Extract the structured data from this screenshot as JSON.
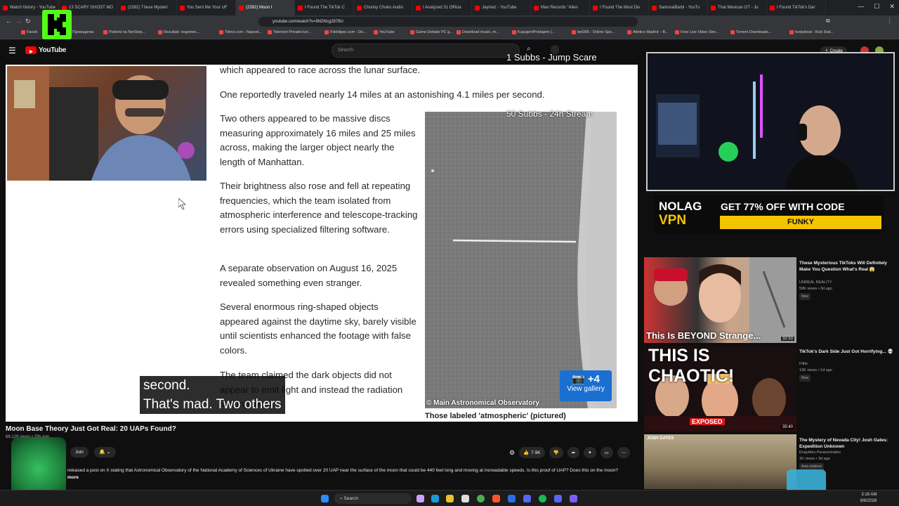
{
  "browser": {
    "tabs": [
      {
        "label": "Watch history - YouTube",
        "active": false
      },
      {
        "label": "13 SCARY GHOST MO",
        "active": false
      },
      {
        "label": "(2392) These Mysteri",
        "active": false
      },
      {
        "label": "You Sent Me Your UF",
        "active": false
      },
      {
        "label": "(2392) Moon I",
        "active": true
      },
      {
        "label": "I Found The TikTok C",
        "active": false
      },
      {
        "label": "Chunky Choko Audio",
        "active": false
      },
      {
        "label": "I Analyzed 31 Officia",
        "active": false
      },
      {
        "label": "Jaymez - YouTube",
        "active": false
      },
      {
        "label": "Man Records \"Alien",
        "active": false
      },
      {
        "label": "I Found The Most Dis",
        "active": false
      },
      {
        "label": "SamuraiBarbi - YouTu",
        "active": false
      },
      {
        "label": "That Mexican OT - Jo",
        "active": false
      },
      {
        "label": "I Found TikTok's Dar",
        "active": false
      }
    ],
    "url": "youtube.com/watch?v=9hDNcg2878U",
    "bookmarks": [
      "Faceb",
      "Преводачка",
      "Pokloni na NorStop...",
      "Rezultati: nogomet,...",
      "Titlovi.com - Najved...",
      "Telemori Privatni kor...",
      "FileHippo.com - Do...",
      "YouTube",
      "Game-Debate PC g...",
      "Download music, m...",
      "KupujemProdajem |...",
      "bet365 - Online Spo...",
      "Atletico Madrid – B...",
      "Free Live Video Stre...",
      "Torrent Downloads...",
      "funkybeat - Kick Stat..."
    ]
  },
  "youtube": {
    "logo": "YouTube",
    "search_placeholder": "Search",
    "create_label": "Create"
  },
  "overlay": {
    "subs_line1": "1 Subbs - Jump Scare",
    "subs_line2": "50 Subbs - 24h Stream"
  },
  "article": {
    "paragraphs": [
      "which appeared to race across the lunar surface.",
      "One reportedly traveled nearly 14 miles at an astonishing 4.1 miles per second.",
      "Two others appeared to be massive discs measuring approximately 16 miles and 25 miles across, making the larger object nearly the length of Manhattan.",
      "Their brightness also rose and fell at repeating frequencies, which the team isolated from atmospheric interference and telescope-tracking errors using specialized filtering software.",
      "A separate observation on August 16, 2025 revealed something even stranger.",
      "Several enormous ring-shaped objects appeared against the daytime sky, barely visible until scientists enhanced the footage with false colors.",
      "The team claimed the dark objects did not appear to emit light and instead the radiation striking them."
    ],
    "photo_credit": "© Main Astronomical Observatory",
    "gallery_count": "+4",
    "gallery_label": "View gallery",
    "caption": "Those labeled 'atmospheric' (pictured)"
  },
  "subtitle": {
    "line1": "second.",
    "line2": "That's mad. Two others"
  },
  "sponsor": {
    "brand_top": "NOLAG",
    "brand_bottom": "VPN",
    "offer": "GET 77% OFF WITH CODE",
    "code": "FUNKY"
  },
  "recommendations": [
    {
      "title": "These Mysterious TikToks Will Definitely Make You Question What's Real 😱",
      "channel": "UNREAL REALITY",
      "meta": "59K views • 3d ago",
      "new": "New",
      "duration": "32:53",
      "thumb_text": "This Is BEYOND Strange..."
    },
    {
      "title": "TikTok's Dark Side Just Got Horrifying... 💀",
      "channel": "Fiftie",
      "meta": "13K views • 1d ago",
      "new": "New",
      "duration": "35:40",
      "thumb_text": "THIS IS CHAOTIC!",
      "thumb_badge": "EXPOSED"
    },
    {
      "title": "The Mystery of Nevada City! Josh Gates: Expedition Unknown",
      "channel": "Enquêtes Paranormales",
      "meta": "1K views • 3d ago",
      "new": "Auto-dubbed",
      "duration": "",
      "thumb_text": "JOSH GATES"
    }
  ],
  "video": {
    "title": "Moon Base Theory Just Got Real: 20 UAPs Found?",
    "views": "68,129 views • 20h ago",
    "join_label": "Join",
    "likes": "7.9K",
    "description": "released a post on X stating that  Astronomical Observatory of the National Academy of Sciences of Ukraine have spotted over 20 UAP near the surface of the moon that could be 440 feet long and moving at increadable speeds. Is this proof of UAP? Does this on the moon?",
    "more_label": "more"
  },
  "taskbar": {
    "search_label": "Search",
    "time": "3:16 AM",
    "date": "8/6/2026"
  },
  "colors": {
    "yt_red": "#ff0000",
    "kick_green": "#53fc18",
    "vpn_yellow": "#f5c400"
  }
}
